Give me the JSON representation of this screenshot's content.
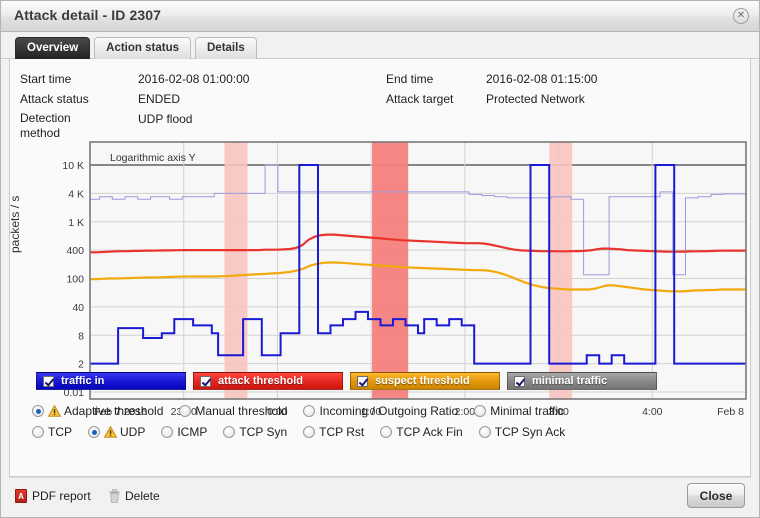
{
  "window": {
    "title": "Attack detail - ID 2307",
    "close_icon": "close-icon"
  },
  "tabs": [
    {
      "label": "Overview",
      "active": true
    },
    {
      "label": "Action status",
      "active": false
    },
    {
      "label": "Details",
      "active": false
    }
  ],
  "details": {
    "start_time_label": "Start time",
    "start_time_value": "2016-02-08 01:00:00",
    "end_time_label": "End time",
    "end_time_value": "2016-02-08 01:15:00",
    "attack_status_label": "Attack status",
    "attack_status_value": "ENDED",
    "attack_target_label": "Attack target",
    "attack_target_value": "Protected Network",
    "detection_method_label": "Detection method",
    "detection_method_value": "UDP flood"
  },
  "chart_data": {
    "type": "line",
    "title": "",
    "annotation": "Logarithmic axis Y",
    "xlabel": "",
    "ylabel": "packets / s",
    "y_scale": "log",
    "y_ticks": [
      "10 K",
      "4 K",
      "1 K",
      "400",
      "100",
      "40",
      "8",
      "2",
      "0.01"
    ],
    "y_tick_values": [
      10000,
      4000,
      1000,
      400,
      100,
      40,
      8,
      2,
      0.01
    ],
    "x_ticks": [
      "Feb 7 2016",
      "23:00",
      "0:00",
      "1:00",
      "2:00",
      "3:00",
      "4:00",
      "Feb 8"
    ],
    "grid": true,
    "legend_position": "below",
    "series": [
      {
        "name": "traffic in",
        "color": "#1a1ad4",
        "values": [
          2,
          2,
          2,
          2,
          2,
          12,
          12,
          12,
          12,
          7,
          7,
          7,
          9,
          9,
          20,
          20,
          20,
          14,
          14,
          14,
          9,
          3,
          3,
          3,
          3,
          20,
          20,
          20,
          3,
          3,
          3,
          9,
          9,
          9,
          12000,
          12000,
          12000,
          9,
          9,
          14,
          14,
          20,
          20,
          30,
          30,
          20,
          20,
          14,
          14,
          20,
          20,
          14,
          14,
          9,
          20,
          20,
          14,
          14,
          20,
          20,
          14,
          14,
          2,
          2,
          2,
          2,
          2,
          2,
          2,
          2,
          2,
          12000,
          12000,
          12000,
          2,
          2,
          2,
          2,
          2,
          2,
          3,
          3,
          2,
          2,
          3,
          3,
          2,
          2,
          2,
          2,
          2,
          12000,
          12000,
          12000,
          2,
          2,
          2,
          2,
          2,
          2,
          2,
          2,
          2,
          2,
          2,
          2
        ]
      },
      {
        "name": "attack threshold",
        "color": "#e8342c",
        "values": [
          360,
          360,
          365,
          370,
          375,
          380,
          380,
          385,
          385,
          390,
          390,
          392,
          395,
          395,
          398,
          400,
          400,
          400,
          400,
          400,
          400,
          400,
          400,
          400,
          400,
          400,
          400,
          400,
          405,
          405,
          405,
          410,
          415,
          430,
          470,
          560,
          620,
          650,
          660,
          660,
          650,
          640,
          630,
          620,
          610,
          600,
          590,
          580,
          570,
          560,
          550,
          545,
          540,
          535,
          530,
          525,
          520,
          515,
          510,
          505,
          500,
          500,
          500,
          495,
          480,
          460,
          440,
          420,
          405,
          395,
          390,
          385,
          380,
          380,
          380,
          378,
          378,
          380,
          382,
          385,
          395,
          410,
          420,
          420,
          415,
          410,
          400,
          395,
          390,
          385,
          380,
          375,
          372,
          370,
          370,
          372,
          375,
          378,
          380,
          382,
          385,
          388,
          390,
          390,
          390,
          390
        ]
      },
      {
        "name": "suspect threshold",
        "color": "#f2a90c",
        "values": [
          98,
          98,
          99,
          100,
          100,
          101,
          102,
          103,
          104,
          105,
          105,
          106,
          107,
          108,
          109,
          110,
          110,
          110,
          110,
          110,
          110,
          112,
          113,
          115,
          118,
          120,
          122,
          124,
          126,
          128,
          130,
          135,
          140,
          150,
          165,
          190,
          205,
          215,
          218,
          218,
          215,
          210,
          205,
          200,
          196,
          192,
          188,
          184,
          180,
          176,
          173,
          170,
          168,
          166,
          164,
          162,
          160,
          158,
          156,
          154,
          152,
          150,
          150,
          148,
          140,
          130,
          118,
          105,
          95,
          88,
          82,
          78,
          75,
          73,
          72,
          71,
          70,
          70,
          70,
          70,
          72,
          76,
          80,
          80,
          78,
          76,
          74,
          72,
          70,
          69,
          68,
          67,
          66,
          66,
          66,
          67,
          68,
          68,
          69,
          69,
          70,
          70,
          70,
          70,
          70
        ]
      },
      {
        "name": "minimal traffic",
        "color": "#9a9ae0",
        "values": [
          3000,
          3000,
          3400,
          3400,
          3000,
          3000,
          3400,
          3400,
          3000,
          3000,
          3400,
          3400,
          3400,
          3000,
          3000,
          3400,
          3400,
          3400,
          3400,
          3400,
          4000,
          4000,
          4000,
          4000,
          4000,
          4000,
          4000,
          4000,
          12000,
          12000,
          4200,
          4200,
          4200,
          4200,
          4200,
          4200,
          4200,
          4200,
          4200,
          4200,
          4200,
          4200,
          4200,
          4200,
          4200,
          4200,
          4200,
          4200,
          4200,
          4200,
          4200,
          4200,
          4200,
          4200,
          4200,
          4200,
          4200,
          4200,
          4200,
          4200,
          3800,
          3800,
          3600,
          3600,
          3400,
          3400,
          3200,
          3200,
          3200,
          3200,
          3200,
          3200,
          3200,
          3400,
          3400,
          3400,
          3000,
          3000,
          120,
          120,
          120,
          120,
          3400,
          3400,
          3400,
          3400,
          3400,
          3400,
          3400,
          3400,
          4200,
          4200,
          120,
          120,
          3200,
          3200,
          3400,
          3400,
          3800,
          3800,
          3900,
          3900,
          3900,
          3900
        ]
      }
    ],
    "attack_bands": [
      {
        "start_pct": 20.5,
        "end_pct": 24.0,
        "intensity": "light"
      },
      {
        "start_pct": 43.0,
        "end_pct": 48.5,
        "intensity": "strong"
      },
      {
        "start_pct": 70.0,
        "end_pct": 73.5,
        "intensity": "light"
      }
    ]
  },
  "legend": [
    {
      "label": "traffic in",
      "color": "#1a1ad4",
      "checked": true
    },
    {
      "label": "attack threshold",
      "color": "#e42a22",
      "checked": true
    },
    {
      "label": "suspect threshold",
      "color": "#e39a10",
      "checked": true
    },
    {
      "label": "minimal traffic",
      "color": "#8a8a8a",
      "checked": true
    }
  ],
  "radio_rows": [
    [
      {
        "label": "Adaptive threshold",
        "selected": true,
        "warning": true
      },
      {
        "label": "Manual threshold",
        "selected": false,
        "warning": false
      },
      {
        "label": "Incoming / Outgoing Ratio",
        "selected": false,
        "warning": false
      },
      {
        "label": "Minimal traffic",
        "selected": false,
        "warning": false
      }
    ],
    [
      {
        "label": "TCP",
        "selected": false,
        "warning": false
      },
      {
        "label": "UDP",
        "selected": true,
        "warning": true
      },
      {
        "label": "ICMP",
        "selected": false,
        "warning": false
      },
      {
        "label": "TCP Syn",
        "selected": false,
        "warning": false
      },
      {
        "label": "TCP Rst",
        "selected": false,
        "warning": false
      },
      {
        "label": "TCP Ack Fin",
        "selected": false,
        "warning": false
      },
      {
        "label": "TCP Syn Ack",
        "selected": false,
        "warning": false
      }
    ]
  ],
  "footer": {
    "pdf_label": "PDF report",
    "pdf_icon": "pdf-file-icon",
    "delete_label": "Delete",
    "delete_icon": "trash-icon",
    "close_label": "Close"
  }
}
